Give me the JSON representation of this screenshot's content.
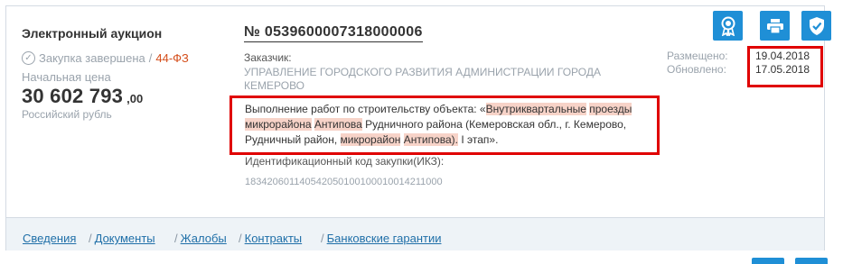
{
  "procurement": {
    "type": "Электронный аукцион",
    "status": "Закупка завершена",
    "law_sep": "/",
    "law": "44-ФЗ",
    "price_label": "Начальная цена",
    "price_main": "30 602 793",
    "price_cents": ",00",
    "currency": "Российский рубль",
    "number": "№ 0539600007318000006",
    "customer_label": "Заказчик:",
    "customer_name": "УПРАВЛЕНИЕ ГОРОДСКОГО РАЗВИТИЯ АДМИНИСТРАЦИИ ГОРОДА КЕМЕРОВО",
    "description_parts": [
      "Выполнение работ по строительству объекта: «",
      "Внутриквартальные",
      " ",
      "проезды",
      " ",
      "микрорайона",
      " ",
      "Антипова",
      " Рудничного района (Кемеровская обл., г. Кемерово, Рудничный район, ",
      "микрорайон",
      " ",
      "Антипова).",
      " I этап»."
    ],
    "ikz_label": "Идентификационный код закупки(ИКЗ):",
    "ikz_value": "183420601140542050100100010014211000"
  },
  "dates": {
    "posted_label": "Размещено:",
    "updated_label": "Обновлено:",
    "posted": "19.04.2018",
    "updated": "17.05.2018"
  },
  "actions": {
    "icons": [
      "award-icon",
      "print-icon",
      "shield-check-icon"
    ]
  },
  "tabs": [
    {
      "label": "Сведения"
    },
    {
      "label": "Документы"
    },
    {
      "label": "Жалобы"
    },
    {
      "label": "Контракты"
    },
    {
      "label": "Банковские гарантии"
    }
  ],
  "colors": {
    "accent": "#1f8fd6",
    "highlight_box": "#e00000",
    "law": "#d44d1a",
    "search_highlight": "#f7d3c8",
    "tab_bar": "#eef3f7"
  }
}
